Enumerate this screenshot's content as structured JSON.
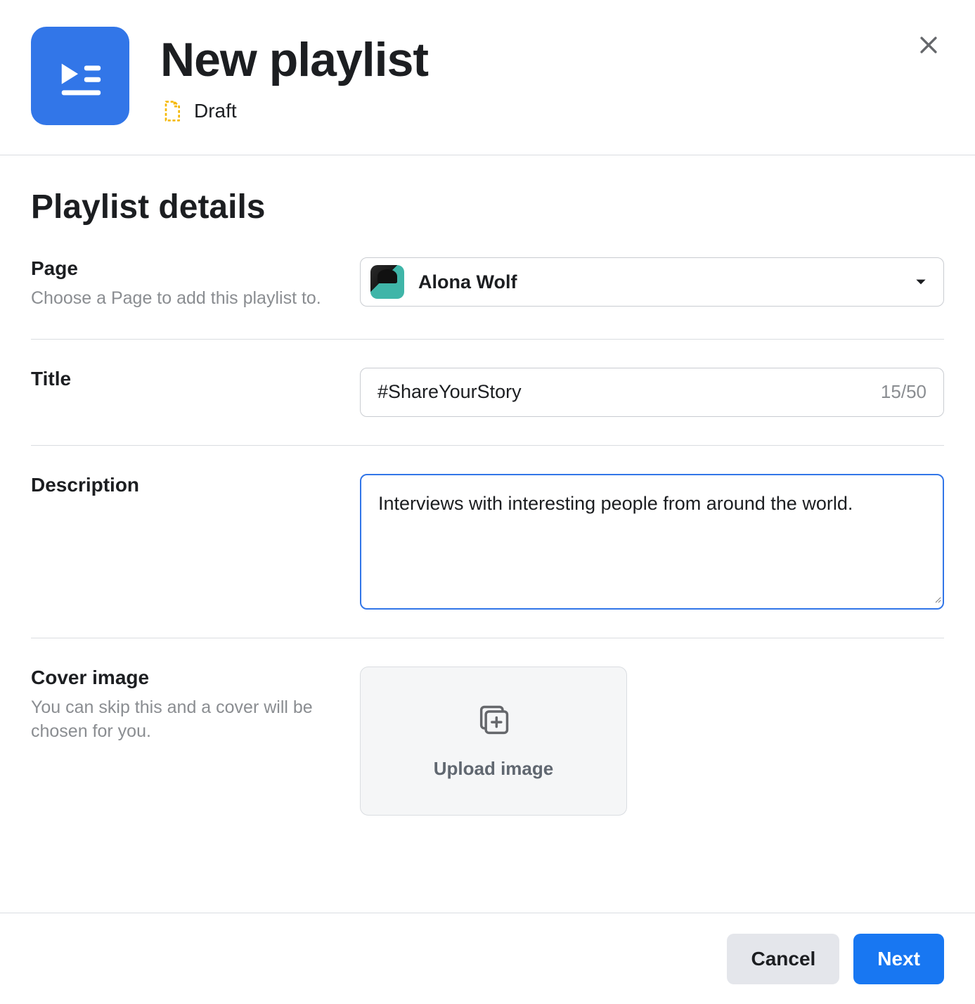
{
  "header": {
    "title": "New playlist",
    "status_label": "Draft"
  },
  "section": {
    "heading": "Playlist details"
  },
  "page_field": {
    "label": "Page",
    "hint": "Choose a Page to add this playlist to.",
    "selected_name": "Alona Wolf"
  },
  "title_field": {
    "label": "Title",
    "value": "#ShareYourStory",
    "count": "15/50"
  },
  "description_field": {
    "label": "Description",
    "value": "Interviews with interesting people from around the world."
  },
  "cover_field": {
    "label": "Cover image",
    "hint": "You can skip this and a cover will be chosen for you.",
    "upload_label": "Upload image"
  },
  "footer": {
    "cancel": "Cancel",
    "next": "Next"
  }
}
